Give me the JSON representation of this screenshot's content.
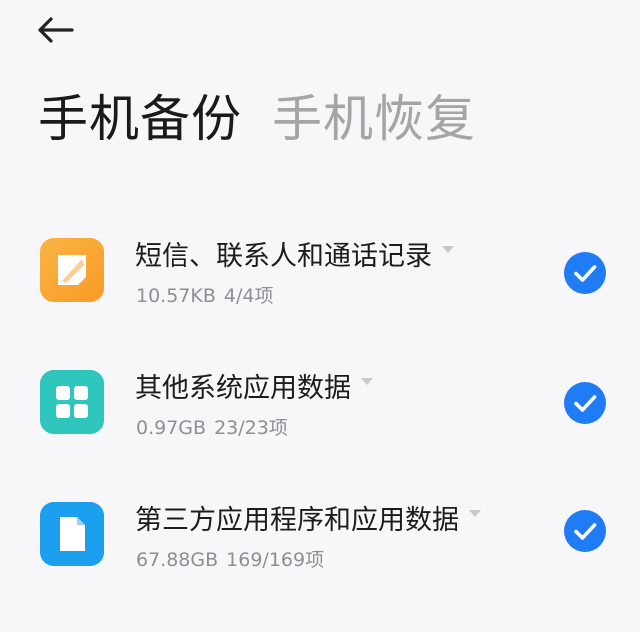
{
  "header": {
    "back_icon": "arrow-left-icon",
    "tabs": [
      {
        "label": "手机备份",
        "active": true
      },
      {
        "label": "手机恢复",
        "active": false
      }
    ]
  },
  "items": [
    {
      "title": "短信、联系人和通话记录",
      "size": "10.57KB",
      "count": "4/4项",
      "icon": "message-icon",
      "icon_color": "#f9a534",
      "checked": true
    },
    {
      "title": "其他系统应用数据",
      "size": "0.97GB",
      "count": "23/23项",
      "icon": "apps-grid-icon",
      "icon_color": "#2ec6bd",
      "checked": true
    },
    {
      "title": "第三方应用程序和应用数据",
      "size": "67.88GB",
      "count": "169/169项",
      "icon": "file-icon",
      "icon_color": "#1d9ff0",
      "checked": true
    }
  ],
  "colors": {
    "check": "#1f7cf4",
    "background": "#f7f7f9"
  }
}
